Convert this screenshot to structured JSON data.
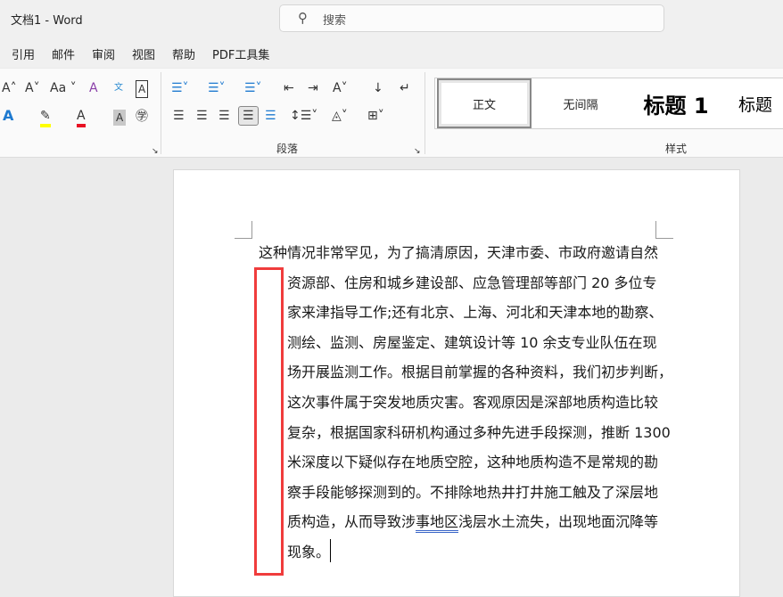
{
  "window": {
    "title": "文档1  -  Word"
  },
  "search": {
    "placeholder": "搜索",
    "icon": "search-icon"
  },
  "menu": [
    "引用",
    "邮件",
    "审阅",
    "视图",
    "帮助",
    "PDF工具集"
  ],
  "ribbon": {
    "font_group_label": "",
    "paragraph_group_label": "段落",
    "styles_group_label": "样式",
    "styles": [
      "正文",
      "无间隔",
      "标题 1",
      "标题"
    ],
    "highlight_color": "#ffff00",
    "font_color": "#e81123"
  },
  "document": {
    "lines": [
      "这种情况非常罕见，为了搞清原因，天津市委、市政府邀请自然",
      "资源部、住房和城乡建设部、应急管理部等部门 20 多位专",
      "家来津指导工作;还有北京、上海、河北和天津本地的勘察、",
      "测绘、监测、房屋鉴定、建筑设计等 10 余支专业队伍在现",
      "场开展监测工作。根据目前掌握的各种资料，我们初步判断，",
      "这次事件属于突发地质灾害。客观原因是深部地质构造比较",
      "复杂，根据国家科研机构通过多种先进手段探测，推断 1300",
      "米深度以下疑似存在地质空腔，这种地质构造不是常规的勘",
      "察手段能够探测到的。不排除地热井打井施工触及了深层地"
    ],
    "line10": {
      "before": "质构造，从而导致涉",
      "underlined": "事地区",
      "after": "浅层水土流失，出现地面沉降等"
    },
    "last_line": "现象。",
    "highlight_box_color": "#f03c3c"
  }
}
